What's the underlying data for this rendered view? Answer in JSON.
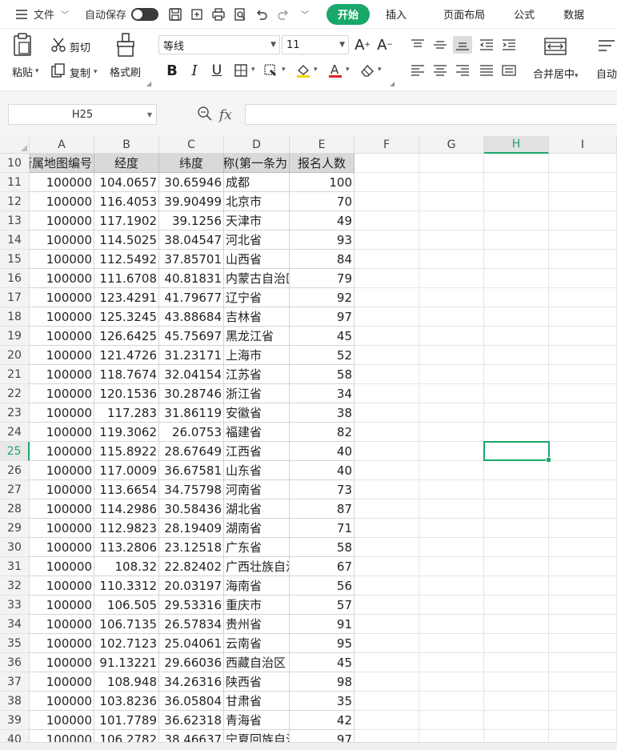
{
  "menubar": {
    "file_label": "文件",
    "autosave_label": "自动保存",
    "tabs": [
      "开始",
      "插入",
      "页面布局",
      "公式",
      "数据"
    ]
  },
  "ribbon": {
    "paste_label": "粘贴",
    "cut_label": "剪切",
    "copy_label": "复制",
    "format_painter_label": "格式刷",
    "font_name": "等线",
    "font_size": "11",
    "merge_label": "合并居中",
    "autofit_label": "自动"
  },
  "formula_bar": {
    "name_box": "H25",
    "fx_label": "fx",
    "formula": ""
  },
  "grid": {
    "columns": [
      "A",
      "B",
      "C",
      "D",
      "E",
      "F",
      "G",
      "H",
      "I"
    ],
    "active_column": "H",
    "active_row": "25",
    "header_row": {
      "row": "10",
      "cells": [
        "所属地图编号",
        "经度",
        "纬度",
        "名称(第一条为",
        "报名人数"
      ]
    },
    "rows": [
      {
        "row": "11",
        "a": "100000",
        "b": "104.0657",
        "c": "30.65946",
        "d": "成都",
        "e": "100"
      },
      {
        "row": "12",
        "a": "100000",
        "b": "116.4053",
        "c": "39.90499",
        "d": "北京市",
        "e": "70"
      },
      {
        "row": "13",
        "a": "100000",
        "b": "117.1902",
        "c": "39.1256",
        "d": "天津市",
        "e": "49"
      },
      {
        "row": "14",
        "a": "100000",
        "b": "114.5025",
        "c": "38.04547",
        "d": "河北省",
        "e": "93"
      },
      {
        "row": "15",
        "a": "100000",
        "b": "112.5492",
        "c": "37.85701",
        "d": "山西省",
        "e": "84"
      },
      {
        "row": "16",
        "a": "100000",
        "b": "111.6708",
        "c": "40.81831",
        "d": "内蒙古自治区",
        "e": "79"
      },
      {
        "row": "17",
        "a": "100000",
        "b": "123.4291",
        "c": "41.79677",
        "d": "辽宁省",
        "e": "92"
      },
      {
        "row": "18",
        "a": "100000",
        "b": "125.3245",
        "c": "43.88684",
        "d": "吉林省",
        "e": "97"
      },
      {
        "row": "19",
        "a": "100000",
        "b": "126.6425",
        "c": "45.75697",
        "d": "黑龙江省",
        "e": "45"
      },
      {
        "row": "20",
        "a": "100000",
        "b": "121.4726",
        "c": "31.23171",
        "d": "上海市",
        "e": "52"
      },
      {
        "row": "21",
        "a": "100000",
        "b": "118.7674",
        "c": "32.04154",
        "d": "江苏省",
        "e": "58"
      },
      {
        "row": "22",
        "a": "100000",
        "b": "120.1536",
        "c": "30.28746",
        "d": "浙江省",
        "e": "34"
      },
      {
        "row": "23",
        "a": "100000",
        "b": "117.283",
        "c": "31.86119",
        "d": "安徽省",
        "e": "38"
      },
      {
        "row": "24",
        "a": "100000",
        "b": "119.3062",
        "c": "26.0753",
        "d": "福建省",
        "e": "82"
      },
      {
        "row": "25",
        "a": "100000",
        "b": "115.8922",
        "c": "28.67649",
        "d": "江西省",
        "e": "40"
      },
      {
        "row": "26",
        "a": "100000",
        "b": "117.0009",
        "c": "36.67581",
        "d": "山东省",
        "e": "40"
      },
      {
        "row": "27",
        "a": "100000",
        "b": "113.6654",
        "c": "34.75798",
        "d": "河南省",
        "e": "73"
      },
      {
        "row": "28",
        "a": "100000",
        "b": "114.2986",
        "c": "30.58436",
        "d": "湖北省",
        "e": "87"
      },
      {
        "row": "29",
        "a": "100000",
        "b": "112.9823",
        "c": "28.19409",
        "d": "湖南省",
        "e": "71"
      },
      {
        "row": "30",
        "a": "100000",
        "b": "113.2806",
        "c": "23.12518",
        "d": "广东省",
        "e": "58"
      },
      {
        "row": "31",
        "a": "100000",
        "b": "108.32",
        "c": "22.82402",
        "d": "广西壮族自治区",
        "e": "67"
      },
      {
        "row": "32",
        "a": "100000",
        "b": "110.3312",
        "c": "20.03197",
        "d": "海南省",
        "e": "56"
      },
      {
        "row": "33",
        "a": "100000",
        "b": "106.505",
        "c": "29.53316",
        "d": "重庆市",
        "e": "57"
      },
      {
        "row": "34",
        "a": "100000",
        "b": "106.7135",
        "c": "26.57834",
        "d": "贵州省",
        "e": "91"
      },
      {
        "row": "35",
        "a": "100000",
        "b": "102.7123",
        "c": "25.04061",
        "d": "云南省",
        "e": "95"
      },
      {
        "row": "36",
        "a": "100000",
        "b": "91.13221",
        "c": "29.66036",
        "d": "西藏自治区",
        "e": "45"
      },
      {
        "row": "37",
        "a": "100000",
        "b": "108.948",
        "c": "34.26316",
        "d": "陕西省",
        "e": "98"
      },
      {
        "row": "38",
        "a": "100000",
        "b": "103.8236",
        "c": "36.05804",
        "d": "甘肃省",
        "e": "35"
      },
      {
        "row": "39",
        "a": "100000",
        "b": "101.7789",
        "c": "36.62318",
        "d": "青海省",
        "e": "42"
      },
      {
        "row": "40",
        "a": "100000",
        "b": "106.2782",
        "c": "38.46637",
        "d": "宁夏回族自治区",
        "e": "97"
      }
    ]
  },
  "colors": {
    "accent": "#1aa86a",
    "header_fill": "#d9d9d9"
  }
}
